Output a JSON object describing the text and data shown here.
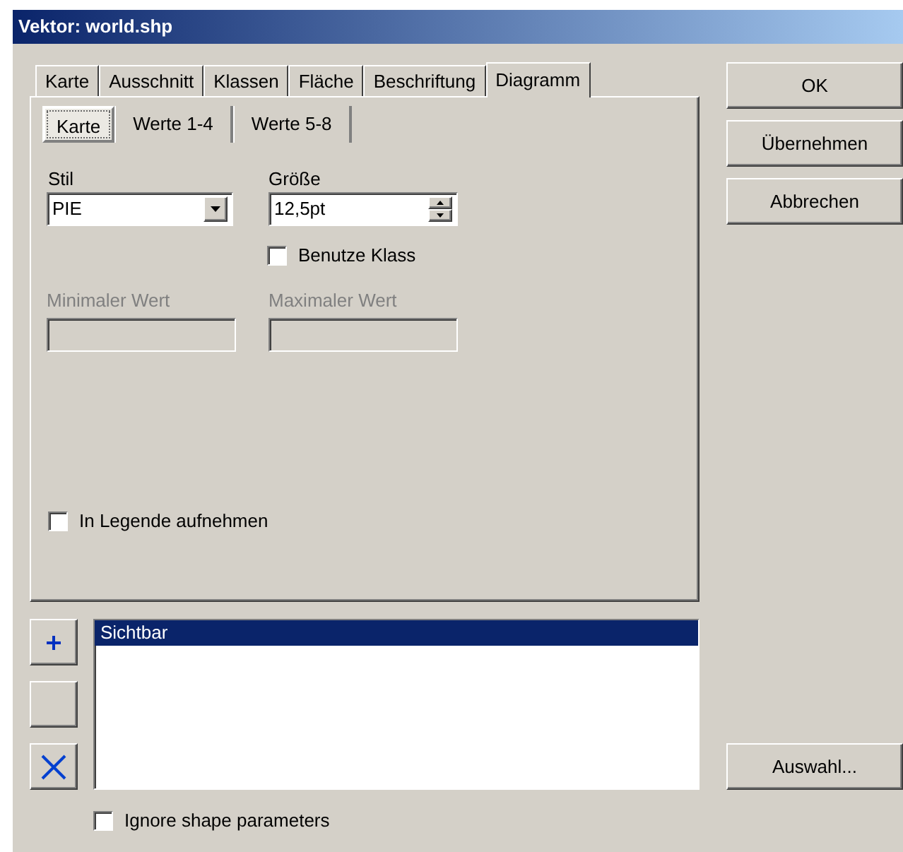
{
  "window": {
    "title": "Vektor: world.shp"
  },
  "tabs": [
    {
      "label": "Karte",
      "selected": false
    },
    {
      "label": "Ausschnitt",
      "selected": false
    },
    {
      "label": "Klassen",
      "selected": false
    },
    {
      "label": "Fläche",
      "selected": false
    },
    {
      "label": "Beschriftung",
      "selected": false
    },
    {
      "label": "Diagramm",
      "selected": true
    }
  ],
  "subtabs": [
    {
      "label": "Karte",
      "selected": true
    },
    {
      "label": "Werte 1-4",
      "selected": false
    },
    {
      "label": "Werte 5-8",
      "selected": false
    }
  ],
  "stil": {
    "label": "Stil",
    "value": "PIE"
  },
  "groesse": {
    "label": "Größe",
    "value": "12,5pt"
  },
  "benutze_klass": {
    "label": "Benutze Klass",
    "checked": false
  },
  "min": {
    "label": "Minimaler Wert",
    "disabled": true
  },
  "max": {
    "label": "Maximaler Wert",
    "disabled": true
  },
  "legende": {
    "label": "In Legende aufnehmen",
    "checked": false
  },
  "side_buttons": [
    "OK",
    "Übernehmen",
    "Abbrechen"
  ],
  "list_items": [
    {
      "label": "Sichtbar",
      "selected": true
    }
  ],
  "list_tools": [
    {
      "kind": "add"
    },
    {
      "kind": "blank"
    },
    {
      "kind": "delete"
    }
  ],
  "select_button": "Auswahl...",
  "ignore_shape": {
    "label": "Ignore shape parameters",
    "checked": false
  }
}
